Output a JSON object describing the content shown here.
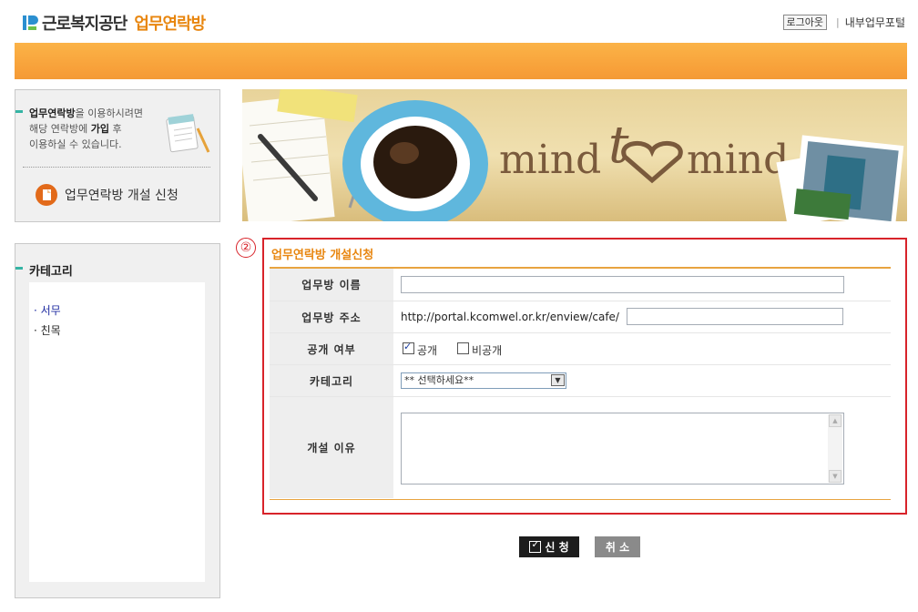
{
  "header": {
    "org_name": "근로복지공단",
    "app_name": "업무연락방",
    "logout_label": "로그아웃",
    "portal_label": "내부업무포털"
  },
  "sidebar": {
    "info_text_bold": "업무연락방",
    "info_text_line1_rest": "을 이용하시려면",
    "info_text_line2_pre": "해당 연락방에 ",
    "info_text_line2_bold": "가입",
    "info_text_line2_post": " 후",
    "info_text_line3": "이용하실 수 있습니다.",
    "open_request_label": "업무연락방 개설 신청",
    "category_title": "카테고리",
    "categories": [
      {
        "label": "서무",
        "active": true
      },
      {
        "label": "친목",
        "active": false
      }
    ]
  },
  "banner": {
    "text_left": "mind",
    "text_right": "mind"
  },
  "form": {
    "step": "②",
    "title": "업무연락방 개설신청",
    "fields": {
      "name_label": "업무방 이름",
      "name_value": "",
      "address_label": "업무방 주소",
      "address_prefix": "http://portal.kcomwel.or.kr/enview/cafe/",
      "address_value": "",
      "public_label": "공개 여부",
      "public_option": "공개",
      "public_checked": true,
      "private_option": "비공개",
      "private_checked": false,
      "category_label": "카테고리",
      "category_selected": "** 선택하세요**",
      "reason_label": "개설 이유",
      "reason_value": ""
    }
  },
  "buttons": {
    "submit_label": "신 청",
    "cancel_label": "취 소"
  },
  "colors": {
    "accent_orange": "#e8860f",
    "header_bar": "#f8a13a",
    "form_border": "#d8232a",
    "teal_dash": "#35b4a4"
  }
}
